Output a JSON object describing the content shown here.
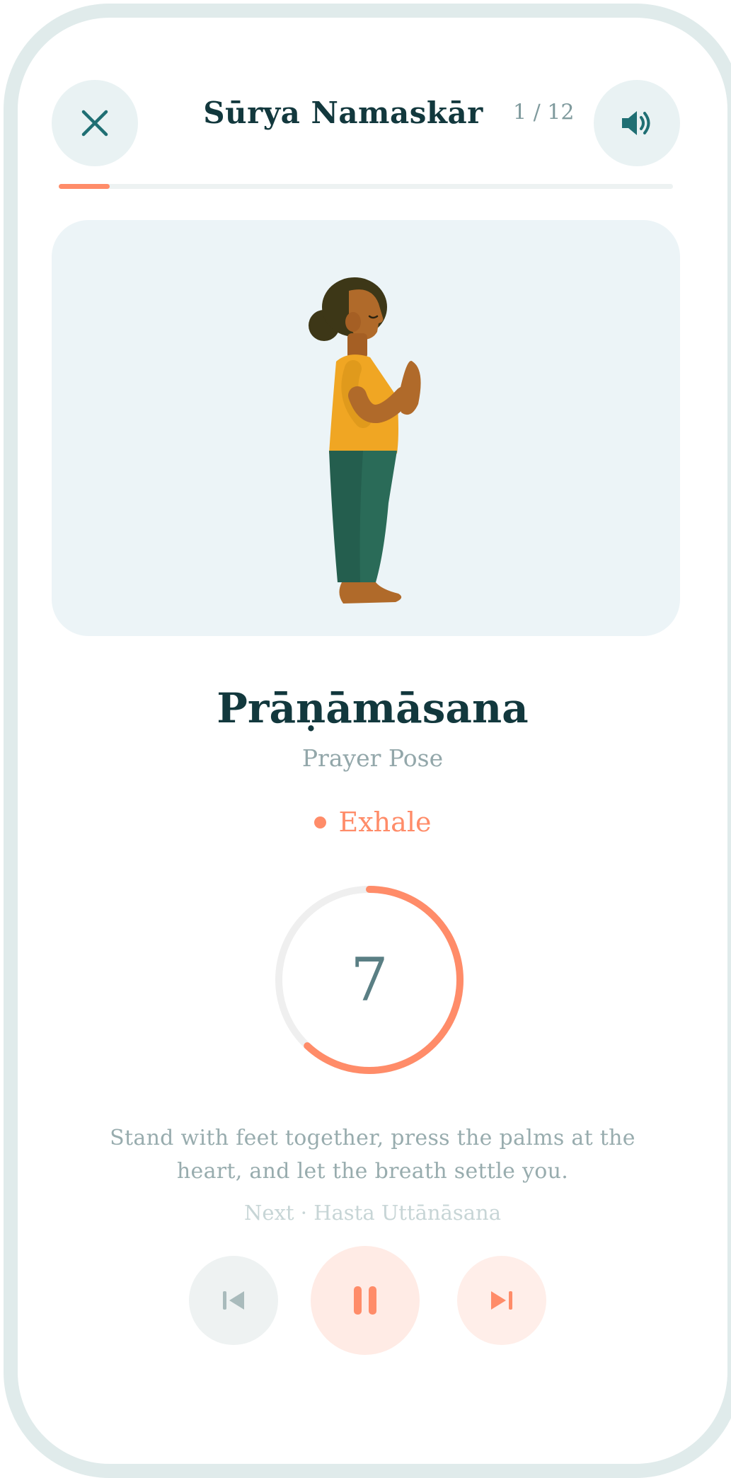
{
  "header": {
    "title": "Sūrya Namaskār",
    "counter": "1 / 12",
    "close_icon": "close-icon",
    "sound_icon": "speaker-icon"
  },
  "progress": {
    "current": 1,
    "total": 12,
    "fraction": 0.083
  },
  "pose": {
    "name": "Prāṇāmāsana",
    "english": "Prayer Pose",
    "breath": "Exhale",
    "count": "7",
    "count_fraction": 0.62,
    "description": "Stand with feet together, press the palms at the heart, and let the breath settle you.",
    "next": "Next · Hasta Uttānāsana",
    "illustration_icon": "standing-prayer-figure"
  },
  "controls": {
    "previous_icon": "skip-previous-icon",
    "pause_icon": "pause-icon",
    "next_icon": "skip-next-icon"
  },
  "colors": {
    "accent": "#ff8c69",
    "ink": "#12383d",
    "muted": "#93a7aa",
    "card_bg": "#ecf4f7",
    "frame": "#e0ebeb"
  }
}
